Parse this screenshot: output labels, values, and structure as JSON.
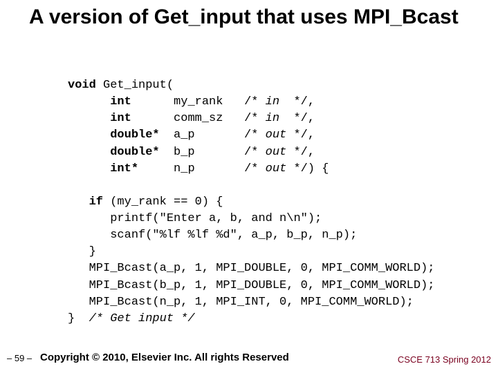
{
  "title": "A version of Get_input that uses MPI_Bcast",
  "code": {
    "l0a": "void",
    "l0b": " Get_input(",
    "l1a": "      int",
    "l1b": "      my_rank   ",
    "l1c": "/* ",
    "l1d": "in",
    "l1e": "  */",
    "l1f": ",",
    "l2a": "      int",
    "l2b": "      comm_sz   ",
    "l2c": "/* ",
    "l2d": "in",
    "l2e": "  */",
    "l2f": ",",
    "l3a": "      double*",
    "l3b": "  a_p       ",
    "l3c": "/* ",
    "l3d": "out",
    "l3e": " */",
    "l3f": ",",
    "l4a": "      double*",
    "l4b": "  b_p       ",
    "l4c": "/* ",
    "l4d": "out",
    "l4e": " */",
    "l4f": ",",
    "l5a": "      int*",
    "l5b": "     n_p       ",
    "l5c": "/* ",
    "l5d": "out",
    "l5e": " */",
    "l5f": ") {",
    "l6": "",
    "l7a": "   if",
    "l7b": " (my_rank == 0) {",
    "l8": "      printf(\"Enter a, b, and n\\n\");",
    "l9": "      scanf(\"%lf %lf %d\", a_p, b_p, n_p);",
    "l10": "   }",
    "l11": "   MPI_Bcast(a_p, 1, MPI_DOUBLE, 0, MPI_COMM_WORLD);",
    "l12": "   MPI_Bcast(b_p, 1, MPI_DOUBLE, 0, MPI_COMM_WORLD);",
    "l13": "   MPI_Bcast(n_p, 1, MPI_INT, 0, MPI_COMM_WORLD);",
    "l14a": "}  ",
    "l14b": "/* Get input */"
  },
  "footer": {
    "page": "– 59 –",
    "copyright": "Copyright © 2010, Elsevier Inc. All rights Reserved",
    "course": "CSCE 713 Spring 2012"
  }
}
